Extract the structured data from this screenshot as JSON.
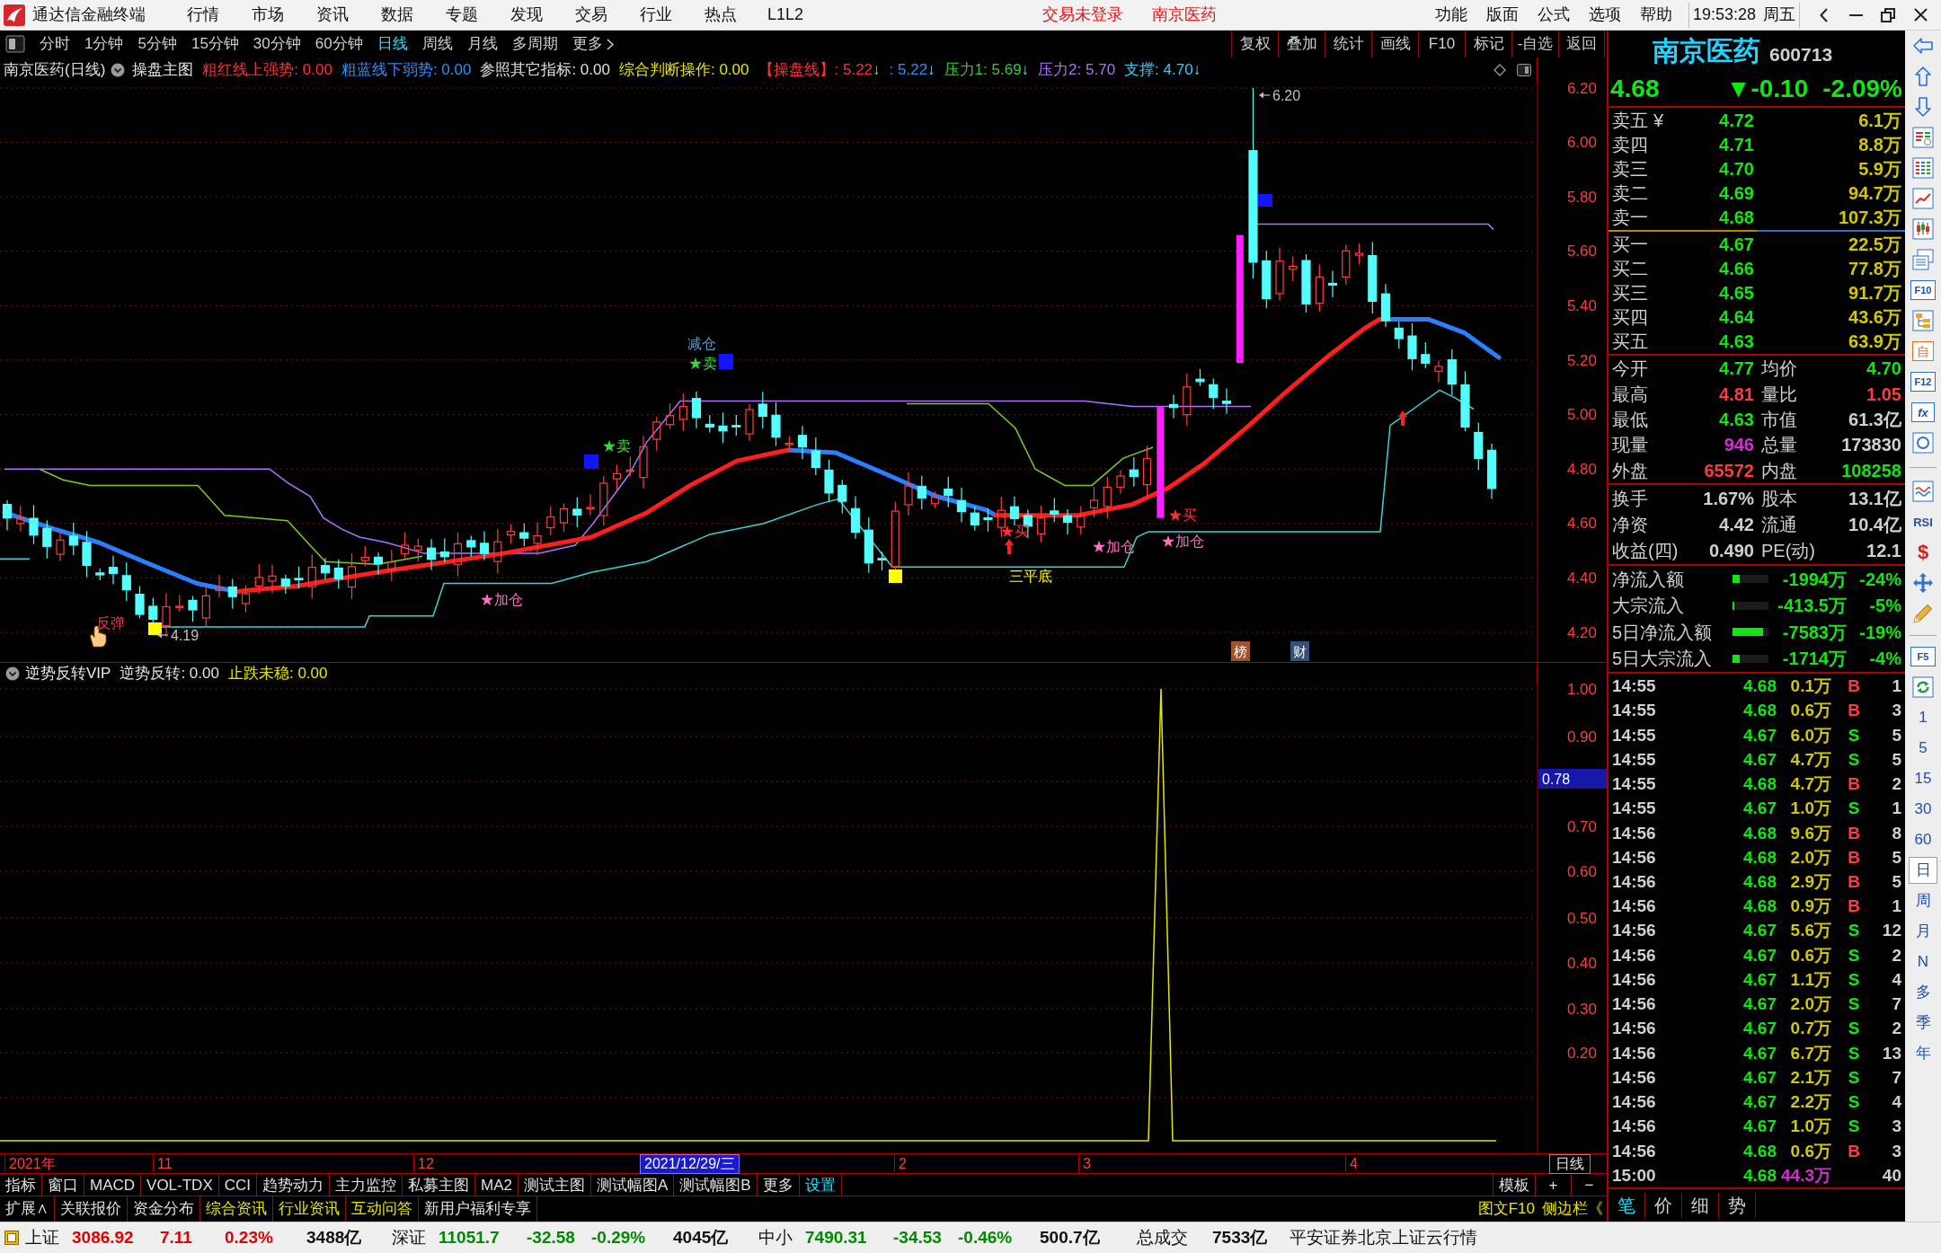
{
  "title_bar": {
    "app_name": "通达信金融终端",
    "menus": [
      "行情",
      "市场",
      "资讯",
      "数据",
      "专题",
      "发现",
      "交易",
      "行业",
      "热点",
      "L1L2"
    ],
    "notices": [
      "交易未登录",
      "南京医药"
    ],
    "right_menus": [
      "功能",
      "版面",
      "公式",
      "选项",
      "帮助"
    ],
    "time": "19:53:28",
    "weekday": "周五"
  },
  "period_tabs": [
    {
      "label": "分时",
      "selected": false
    },
    {
      "label": "1分钟",
      "selected": false
    },
    {
      "label": "5分钟",
      "selected": false
    },
    {
      "label": "15分钟",
      "selected": false
    },
    {
      "label": "30分钟",
      "selected": false
    },
    {
      "label": "60分钟",
      "selected": false
    },
    {
      "label": "日线",
      "selected": true
    },
    {
      "label": "周线",
      "selected": false
    },
    {
      "label": "月线",
      "selected": false
    },
    {
      "label": "多周期",
      "selected": false
    }
  ],
  "more_button": "更多",
  "chart_tools": [
    "复权",
    "叠加",
    "统计",
    "画线",
    "F10",
    "标记",
    "-自选",
    "返回"
  ],
  "main_chart": {
    "title": "南京医药(日线)",
    "indicator": "操盘主图",
    "readouts": [
      {
        "text": "粗红线上强势: 0.00",
        "color": "#ff3232"
      },
      {
        "text": "粗蓝线下弱势: 0.00",
        "color": "#2f8fff"
      },
      {
        "text": "参照其它指标: 0.00",
        "color": "#e0e0e0"
      },
      {
        "text": "综合判断操作: 0.00",
        "color": "#e6e600"
      },
      {
        "text": "【操盘线】: 5.22",
        "color": "#ff3232",
        "arrow": "↓"
      },
      {
        "text": ": 5.22",
        "color": "#2f8fff",
        "arrow": "↓"
      },
      {
        "text": "压力1: 5.69",
        "color": "#33cc33",
        "arrow": "↓"
      },
      {
        "text": "压力2: 5.70",
        "color": "#b070ff"
      },
      {
        "text": "支撑: 4.70",
        "color": "#33ccff",
        "arrow": "↓"
      }
    ],
    "price_axis": [
      "6.20",
      "6.00",
      "5.80",
      "5.60",
      "5.40",
      "5.20",
      "5.00",
      "4.80",
      "4.60",
      "4.40",
      "4.20"
    ],
    "annotations": [
      {
        "text": "反弹",
        "kind": "signal",
        "color": "#ff3232"
      },
      {
        "text": "4.19",
        "kind": "price",
        "color": "#c0c0c0"
      },
      {
        "text": "★加仓",
        "kind": "signal",
        "color": "#ff70c0"
      },
      {
        "text": "★卖",
        "kind": "signal",
        "color": "#33dd33"
      },
      {
        "text": "减仓",
        "kind": "signal",
        "color": "#5b9bd5"
      },
      {
        "text": "★卖",
        "kind": "signal",
        "color": "#33dd33"
      },
      {
        "text": "★买",
        "kind": "signal",
        "color": "#ff3232"
      },
      {
        "text": "三平底",
        "kind": "signal",
        "color": "#ffff00"
      },
      {
        "text": "★加仓",
        "kind": "signal",
        "color": "#ff70c0"
      },
      {
        "text": "★加仓",
        "kind": "signal",
        "color": "#ff70c0"
      },
      {
        "text": "★买",
        "kind": "signal",
        "color": "#ff3232"
      },
      {
        "text": "6.20",
        "kind": "price",
        "color": "#c0c0c0"
      }
    ],
    "badges": [
      {
        "text": "榜",
        "color": "#a0522d"
      },
      {
        "text": "财",
        "color": "#34507a"
      }
    ]
  },
  "sub_chart": {
    "indicator": "逆势反转VIP",
    "readouts": [
      {
        "text": "逆势反转: 0.00",
        "color": "#e0e0e0"
      },
      {
        "text": "止跌未稳: 0.00",
        "color": "#e6e600"
      }
    ],
    "value_axis": [
      "1.00",
      "0.90",
      "0.70",
      "0.60",
      "0.50",
      "0.40",
      "0.30",
      "0.20"
    ],
    "cursor_value": "0.78"
  },
  "date_axis": {
    "labels": [
      "2021年",
      "11",
      "12",
      "2",
      "3",
      "4"
    ],
    "cursor_date": "2021/12/29/三",
    "period": "日线"
  },
  "indicator_tabs": [
    {
      "label": "指标",
      "selected": false
    },
    {
      "label": "窗口",
      "selected": false
    },
    {
      "label": "MACD",
      "selected": false
    },
    {
      "label": "VOL-TDX",
      "selected": false
    },
    {
      "label": "CCI",
      "selected": false
    },
    {
      "label": "趋势动力",
      "selected": false
    },
    {
      "label": "主力监控",
      "selected": false
    },
    {
      "label": "私募主图",
      "selected": false
    },
    {
      "label": "MA2",
      "selected": false
    },
    {
      "label": "测试主图",
      "selected": false
    },
    {
      "label": "测试幅图A",
      "selected": false
    },
    {
      "label": "测试幅图B",
      "selected": false
    },
    {
      "label": "更多",
      "selected": false
    },
    {
      "label": "设置",
      "selected": true
    }
  ],
  "template_controls": [
    "模板",
    "+",
    "−"
  ],
  "extension_links": [
    {
      "label": "扩展∧",
      "color": "#e0e0e0"
    },
    {
      "label": "关联报价",
      "color": "#e0e0e0"
    },
    {
      "label": "资金分布",
      "color": "#e0e0e0"
    },
    {
      "label": "综合资讯",
      "color": "#e6e600"
    },
    {
      "label": "行业资讯",
      "color": "#e6e600"
    },
    {
      "label": "互动问答",
      "color": "#e6e600"
    },
    {
      "label": "新用户福利专享",
      "color": "#e0e0e0"
    }
  ],
  "side_links": [
    "图文F10",
    "侧边栏《"
  ],
  "quote": {
    "name": "南京医药",
    "code": "600713",
    "price": "4.68",
    "change": "▼-0.10",
    "change_pct": "-2.09%",
    "asks": [
      {
        "label": "卖五",
        "symbol": "¥",
        "price": "4.72",
        "volume": "6.1万"
      },
      {
        "label": "卖四",
        "price": "4.71",
        "volume": "8.8万"
      },
      {
        "label": "卖三",
        "price": "4.70",
        "volume": "5.9万"
      },
      {
        "label": "卖二",
        "price": "4.69",
        "volume": "94.7万"
      },
      {
        "label": "卖一",
        "price": "4.68",
        "volume": "107.3万"
      }
    ],
    "bids": [
      {
        "label": "买一",
        "price": "4.67",
        "volume": "22.5万"
      },
      {
        "label": "买二",
        "price": "4.66",
        "volume": "77.8万"
      },
      {
        "label": "买三",
        "price": "4.65",
        "volume": "91.7万"
      },
      {
        "label": "买四",
        "price": "4.64",
        "volume": "43.6万"
      },
      {
        "label": "买五",
        "price": "4.63",
        "volume": "63.9万"
      }
    ],
    "stats": [
      {
        "label": "今开",
        "value": "4.77",
        "color": "#12e612"
      },
      {
        "label": "均价",
        "value": "4.70",
        "color": "#12e612"
      },
      {
        "label": "最高",
        "value": "4.81",
        "color": "#ff3c3c"
      },
      {
        "label": "量比",
        "value": "1.05",
        "color": "#ff3c3c"
      },
      {
        "label": "最低",
        "value": "4.63",
        "color": "#12e612"
      },
      {
        "label": "市值",
        "value": "61.3亿",
        "color": "#d0d0d0"
      },
      {
        "label": "现量",
        "value": "946",
        "color": "#d030d0"
      },
      {
        "label": "总量",
        "value": "173830",
        "color": "#d0d0d0"
      },
      {
        "label": "外盘",
        "value": "65572",
        "color": "#ff3c3c"
      },
      {
        "label": "内盘",
        "value": "108258",
        "color": "#12e612"
      }
    ],
    "fundamentals": [
      {
        "label": "换手",
        "value": "1.67%"
      },
      {
        "label": "股本",
        "value": "13.1亿"
      },
      {
        "label": "净资",
        "value": "4.42"
      },
      {
        "label": "流通",
        "value": "10.4亿"
      },
      {
        "label": "收益(四)",
        "value": "0.490"
      },
      {
        "label": "PE(动)",
        "value": "12.1"
      }
    ],
    "fund_flows": [
      {
        "label": "净流入额",
        "level": 0.2,
        "amount": "-1994万",
        "pct": "-24%"
      },
      {
        "label": "大宗流入",
        "level": 0.05,
        "amount": "-413.5万",
        "pct": "-5%"
      },
      {
        "label": "5日净流入额",
        "level": 0.85,
        "amount": "-7583万",
        "pct": "-19%"
      },
      {
        "label": "5日大宗流入",
        "level": 0.2,
        "amount": "-1714万",
        "pct": "-4%"
      }
    ],
    "trades": [
      {
        "time": "14:55",
        "price": "4.68",
        "volume": "0.1万",
        "side": "B",
        "count": "1",
        "kind": "buy"
      },
      {
        "time": "14:55",
        "price": "4.68",
        "volume": "0.6万",
        "side": "B",
        "count": "3",
        "kind": "buy"
      },
      {
        "time": "14:55",
        "price": "4.67",
        "volume": "6.0万",
        "side": "S",
        "count": "5",
        "kind": "sell"
      },
      {
        "time": "14:55",
        "price": "4.67",
        "volume": "4.7万",
        "side": "S",
        "count": "5",
        "kind": "sell"
      },
      {
        "time": "14:55",
        "price": "4.68",
        "volume": "4.7万",
        "side": "B",
        "count": "2",
        "kind": "buy"
      },
      {
        "time": "14:55",
        "price": "4.67",
        "volume": "1.0万",
        "side": "S",
        "count": "1",
        "kind": "sell"
      },
      {
        "time": "14:56",
        "price": "4.68",
        "volume": "9.6万",
        "side": "B",
        "count": "8",
        "kind": "buy"
      },
      {
        "time": "14:56",
        "price": "4.68",
        "volume": "2.0万",
        "side": "B",
        "count": "5",
        "kind": "buy"
      },
      {
        "time": "14:56",
        "price": "4.68",
        "volume": "2.9万",
        "side": "B",
        "count": "5",
        "kind": "buy"
      },
      {
        "time": "14:56",
        "price": "4.68",
        "volume": "0.9万",
        "side": "B",
        "count": "1",
        "kind": "buy"
      },
      {
        "time": "14:56",
        "price": "4.67",
        "volume": "5.6万",
        "side": "S",
        "count": "12",
        "kind": "sell"
      },
      {
        "time": "14:56",
        "price": "4.67",
        "volume": "0.6万",
        "side": "S",
        "count": "2",
        "kind": "sell"
      },
      {
        "time": "14:56",
        "price": "4.67",
        "volume": "1.1万",
        "side": "S",
        "count": "4",
        "kind": "sell"
      },
      {
        "time": "14:56",
        "price": "4.67",
        "volume": "2.0万",
        "side": "S",
        "count": "7",
        "kind": "sell"
      },
      {
        "time": "14:56",
        "price": "4.67",
        "volume": "0.7万",
        "side": "S",
        "count": "2",
        "kind": "sell"
      },
      {
        "time": "14:56",
        "price": "4.67",
        "volume": "6.7万",
        "side": "S",
        "count": "13",
        "kind": "sell"
      },
      {
        "time": "14:56",
        "price": "4.67",
        "volume": "2.1万",
        "side": "S",
        "count": "7",
        "kind": "sell"
      },
      {
        "time": "14:56",
        "price": "4.67",
        "volume": "2.2万",
        "side": "S",
        "count": "4",
        "kind": "sell"
      },
      {
        "time": "14:56",
        "price": "4.67",
        "volume": "1.0万",
        "side": "S",
        "count": "3",
        "kind": "sell"
      },
      {
        "time": "14:56",
        "price": "4.68",
        "volume": "0.6万",
        "side": "B",
        "count": "3",
        "kind": "buy"
      },
      {
        "time": "15:00",
        "price": "4.68",
        "volume": "44.3万",
        "count": "40",
        "kind": "close"
      }
    ],
    "tabs": [
      {
        "label": "笔",
        "selected": true
      },
      {
        "label": "价",
        "selected": false
      },
      {
        "label": "细",
        "selected": false
      },
      {
        "label": "势",
        "selected": false
      }
    ]
  },
  "side_toolbar": {
    "tools": [
      "F10",
      "自",
      "F12",
      "fx",
      "RSI",
      "$",
      "F5"
    ],
    "periods": [
      {
        "label": "1",
        "selected": false
      },
      {
        "label": "5",
        "selected": false
      },
      {
        "label": "15",
        "selected": false
      },
      {
        "label": "30",
        "selected": false
      },
      {
        "label": "60",
        "selected": false
      },
      {
        "label": "日",
        "selected": true
      },
      {
        "label": "周",
        "selected": false
      },
      {
        "label": "月",
        "selected": false
      },
      {
        "label": "N",
        "selected": false
      },
      {
        "label": "多",
        "selected": false
      },
      {
        "label": "季",
        "selected": false
      },
      {
        "label": "年",
        "selected": false
      }
    ]
  },
  "status_bar": {
    "indices": [
      {
        "name": "上证",
        "value": "3086.92",
        "change": "7.11",
        "pct": "0.23%",
        "amount": "3488亿",
        "color": "#e00000"
      },
      {
        "name": "深证",
        "value": "11051.7",
        "change": "-32.58",
        "pct": "-0.29%",
        "amount": "4045亿",
        "color": "#008a00"
      },
      {
        "name": "中小",
        "value": "7490.31",
        "change": "-34.53",
        "pct": "-0.46%",
        "amount": "500.7亿",
        "color": "#008a00"
      }
    ],
    "total_label": "总成交",
    "total_value": "7533亿",
    "server": "平安证券北京上证云行情"
  }
}
